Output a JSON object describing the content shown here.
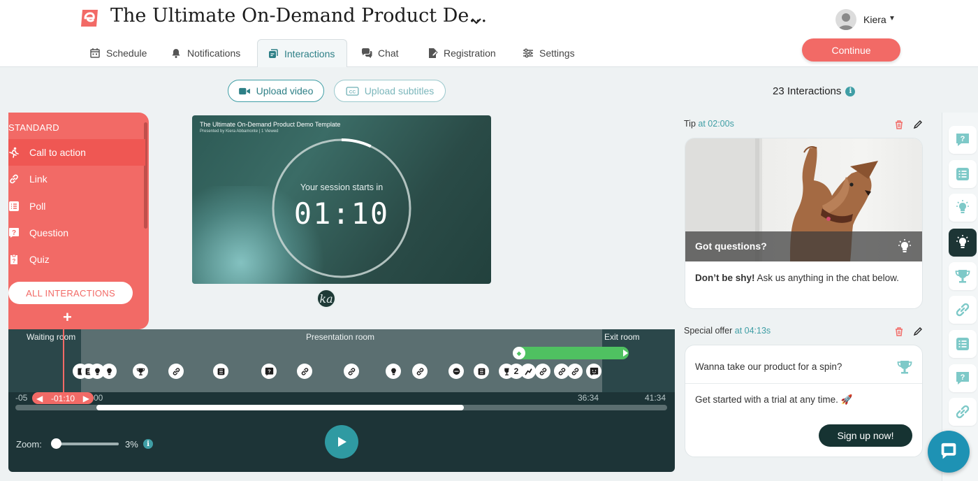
{
  "header": {
    "event_title": "The Ultimate On-Demand Product De...",
    "user": {
      "name": "Kiera"
    },
    "tabs": [
      {
        "label": "Schedule",
        "icon": "calendar-icon"
      },
      {
        "label": "Notifications",
        "icon": "bell-icon"
      },
      {
        "label": "Interactions",
        "icon": "interactions-icon",
        "active": true
      },
      {
        "label": "Chat",
        "icon": "chat-icon"
      },
      {
        "label": "Registration",
        "icon": "registration-icon"
      },
      {
        "label": "Settings",
        "icon": "settings-icon"
      }
    ],
    "continue_label": "Continue"
  },
  "toolbar": {
    "upload_video": "Upload video",
    "upload_subtitles": "Upload subtitles",
    "interactions_count": "23 Interactions"
  },
  "interactions_panel": {
    "heading": "STANDARD",
    "items": [
      {
        "label": "Call to action",
        "icon": "runner-icon",
        "active": true
      },
      {
        "label": "Link",
        "icon": "link-icon"
      },
      {
        "label": "Poll",
        "icon": "poll-icon"
      },
      {
        "label": "Question",
        "icon": "question-icon"
      },
      {
        "label": "Quiz",
        "icon": "quiz-icon"
      }
    ],
    "all_button": "ALL INTERACTIONS",
    "add_symbol": "+"
  },
  "video": {
    "title": "The Ultimate On-Demand Product Demo Template",
    "subtitle": "Presented by Kiera Abbamonte  |  1 Viewed",
    "session_text": "Your session starts in",
    "countdown": "01:10",
    "countdown_progress": 0.07,
    "host_initials": "ka"
  },
  "timeline": {
    "rooms": {
      "waiting": "Waiting room",
      "presentation": "Presentation room",
      "exit": "Exit room"
    },
    "start_time": "-05",
    "start_time_suffix": "00",
    "marker_time": "-01:10",
    "end_time_1": "36:34",
    "end_time_2": "41:34",
    "zoom_label": "Zoom:",
    "zoom_value": "3%",
    "cluster_count": "2",
    "playback_fraction": 0.56
  },
  "cards": [
    {
      "type_label": "Tip",
      "time_label": "at 02:00s",
      "overlay_title": "Got questions?",
      "body_bold": "Don’t be shy!",
      "body_text": " Ask us anything in the chat below."
    },
    {
      "type_label": "Special offer",
      "time_label": "at 04:13s",
      "title": "Wanna take our product for a spin?",
      "body_text": "Get started with a trial at any time. 🚀",
      "button": "Sign up now!"
    }
  ],
  "colors": {
    "brand": "#f26a66",
    "accent": "#3f9ea5",
    "dark": "#1d3437",
    "green": "#4fc161"
  }
}
